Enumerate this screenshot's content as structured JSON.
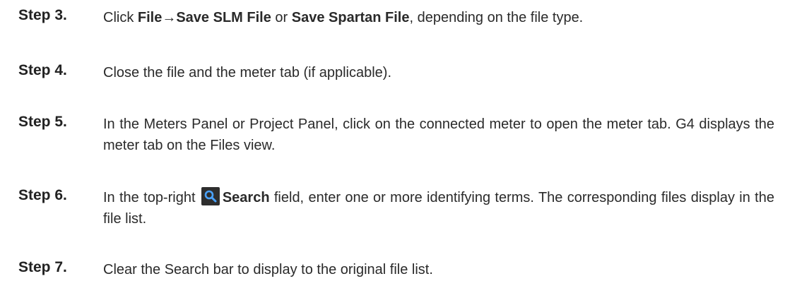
{
  "steps": [
    {
      "label": "Step 3.",
      "pre": "Click ",
      "b1": "File",
      "arrow": "→",
      "b2": "Save SLM File",
      "mid": " or ",
      "b3": "Save Spartan File",
      "post": ", depending on the file type."
    },
    {
      "label": "Step 4.",
      "text": "Close the file and the meter tab (if applicable)."
    },
    {
      "label": "Step 5.",
      "text": "In the Meters Panel or Project Panel, click on the connected meter to open the meter tab. G4 displays the meter tab on the Files view."
    },
    {
      "label": "Step 6.",
      "pre": "In the top-right ",
      "icon": "search-icon",
      "b1": "Search",
      "post": " field, enter one or more identifying terms. The corresponding files display in the file list."
    },
    {
      "label": "Step 7.",
      "text": "Clear the Search bar to display to the original file list."
    }
  ],
  "colors": {
    "text": "#2a2a2a",
    "icon_bg": "#2e2e2e",
    "icon_fg": "#4aa3ff"
  }
}
